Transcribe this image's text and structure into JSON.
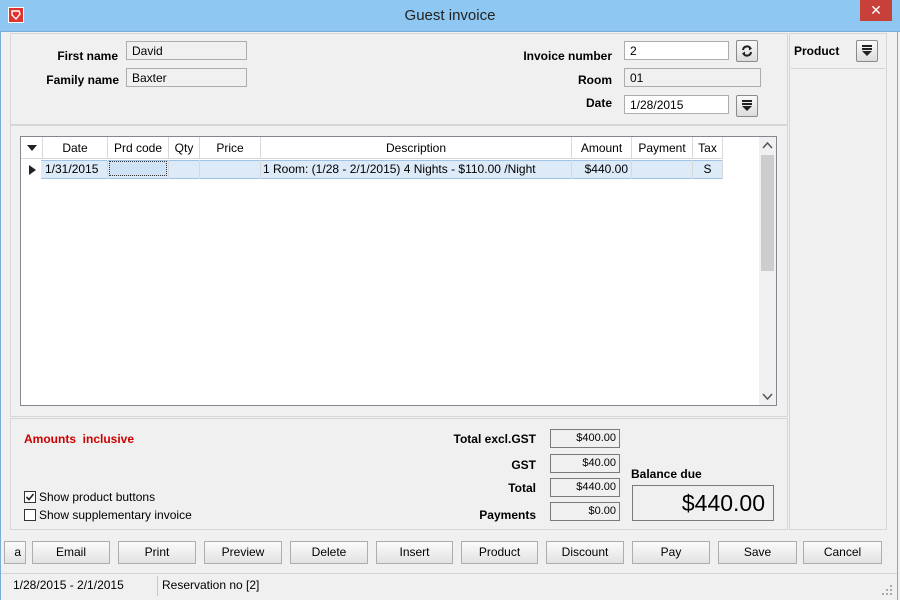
{
  "window": {
    "title": "Guest invoice",
    "close_glyph": "✕",
    "app_icon": "app-logo-icon"
  },
  "guest": {
    "first_name_label": "First name",
    "first_name": "David",
    "family_name_label": "Family name",
    "family_name": "Baxter"
  },
  "invoice": {
    "number_label": "Invoice number",
    "number": "2",
    "room_label": "Room",
    "room": "01",
    "date_label": "Date",
    "date": "1/28/2015"
  },
  "sidebar": {
    "product_label": "Product"
  },
  "grid": {
    "columns": [
      "Date",
      "Prd code",
      "Qty",
      "Price",
      "Description",
      "Amount",
      "Payment",
      "Tax"
    ],
    "rows": [
      {
        "date": "1/31/2015",
        "prd_code": "",
        "qty": "",
        "price": "",
        "description": "1 Room: (1/28 - 2/1/2015) 4 Nights - $110.00 /Night",
        "amount": "$440.00",
        "payment": "",
        "tax": "S"
      }
    ]
  },
  "totals": {
    "amounts_note": "Amounts  inclusive",
    "total_excl_label": "Total excl.GST",
    "total_excl": "$400.00",
    "gst_label": "GST",
    "gst": "$40.00",
    "total_label": "Total",
    "total": "$440.00",
    "payments_label": "Payments",
    "payments": "$0.00",
    "balance_label": "Balance due",
    "balance": "$440.00",
    "note_color": "#cc0000"
  },
  "options": {
    "show_product_buttons_label": "Show product buttons",
    "show_product_buttons": true,
    "show_supplementary_label": "Show supplementary invoice",
    "show_supplementary": false
  },
  "buttons": {
    "partial": "a",
    "email": "Email",
    "print": "Print",
    "preview": "Preview",
    "delete": "Delete",
    "insert": "Insert",
    "product": "Product",
    "discount": "Discount",
    "pay": "Pay",
    "save": "Save",
    "cancel": "Cancel"
  },
  "status": {
    "date_range": "1/28/2015 - 2/1/2015",
    "reservation": "Reservation no [2]"
  }
}
